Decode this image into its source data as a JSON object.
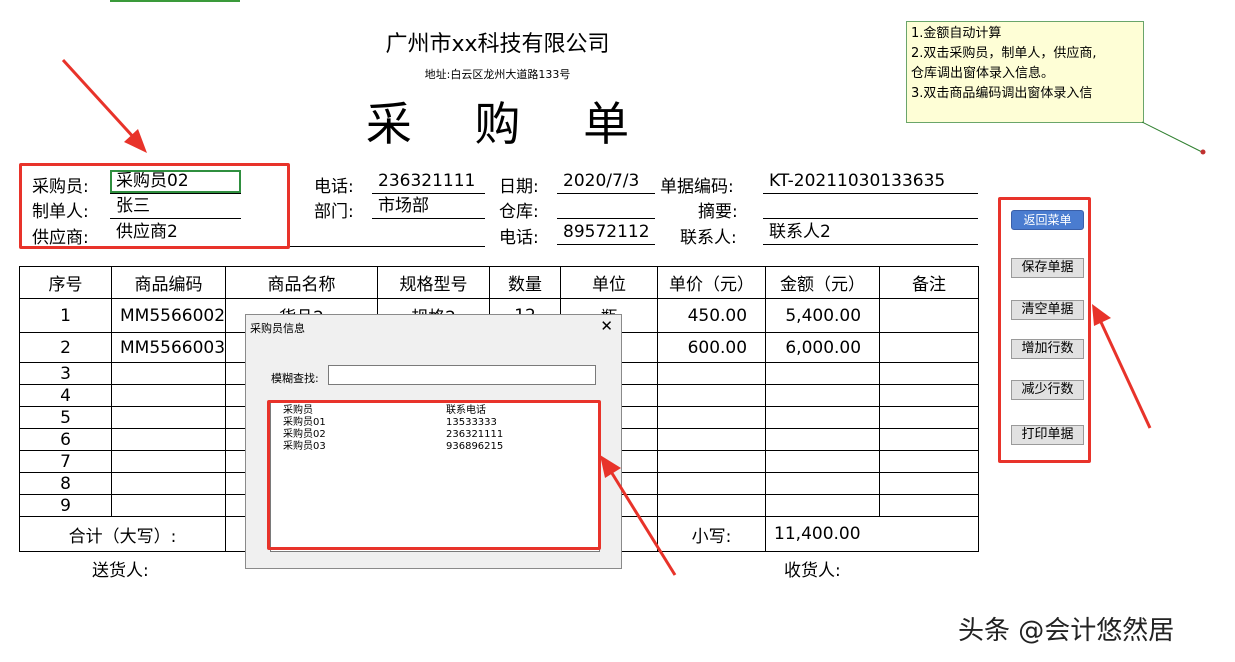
{
  "header": {
    "company": "广州市xx科技有限公司",
    "address": "地址:白云区龙州大道路133号",
    "title": "采 购 单"
  },
  "note": {
    "lines": [
      "1.金额自动计算",
      "2.双击采购员，制单人，供应商,",
      "仓库调出窗体录入信息。",
      "3.双击商品编码调出窗体录入信"
    ]
  },
  "form": {
    "buyer_label": "采购员:",
    "buyer_value": "采购员02",
    "maker_label": "制单人:",
    "maker_value": "张三",
    "supplier_label": "供应商:",
    "supplier_value": "供应商2",
    "phone_label": "电话:",
    "phone_value": "236321111",
    "dept_label": "部门:",
    "dept_value": "市场部",
    "date_label": "日期:",
    "date_value": "2020/7/3",
    "warehouse_label": "仓库:",
    "warehouse_value": "",
    "phone2_label": "电话:",
    "phone2_value": "89572112",
    "docno_label": "单据编码:",
    "docno_value": "KT-20211030133635",
    "summary_label": "摘要:",
    "summary_value": "",
    "contact_label": "联系人:",
    "contact_value": "联系人2"
  },
  "table": {
    "headers": [
      "序号",
      "商品编码",
      "商品名称",
      "规格型号",
      "数量",
      "单位",
      "单价（元）",
      "金额（元）",
      "备注"
    ],
    "rows": [
      [
        "1",
        "MM5566002",
        "货品2",
        "规格2",
        "12",
        "瓶",
        "450.00",
        "5,400.00",
        ""
      ],
      [
        "2",
        "MM5566003",
        "",
        "",
        "",
        "",
        "600.00",
        "6,000.00",
        ""
      ],
      [
        "3",
        "",
        "",
        "",
        "",
        "",
        "",
        "",
        ""
      ],
      [
        "4",
        "",
        "",
        "",
        "",
        "",
        "",
        "",
        ""
      ],
      [
        "5",
        "",
        "",
        "",
        "",
        "",
        "",
        "",
        ""
      ],
      [
        "6",
        "",
        "",
        "",
        "",
        "",
        "",
        "",
        ""
      ],
      [
        "7",
        "",
        "",
        "",
        "",
        "",
        "",
        "",
        ""
      ],
      [
        "8",
        "",
        "",
        "",
        "",
        "",
        "",
        "",
        ""
      ],
      [
        "9",
        "",
        "",
        "",
        "",
        "",
        "",
        "",
        ""
      ]
    ],
    "total_label": "合计（大写）:",
    "small_label": "小写:",
    "small_value": "11,400.00"
  },
  "footer": {
    "deliverer_label": "送货人:",
    "receiver_label": "收货人:"
  },
  "buttons": {
    "back": "返回菜单",
    "save": "保存单据",
    "clear": "清空单据",
    "add_rows": "增加行数",
    "remove_rows": "减少行数",
    "print": "打印单据"
  },
  "dialog": {
    "title": "采购员信息",
    "close": "✕",
    "search_label": "模糊查找:",
    "search_value": "",
    "list": [
      {
        "name": "采购员",
        "phone": "联系电话"
      },
      {
        "name": "采购员01",
        "phone": "13533333"
      },
      {
        "name": "采购员02",
        "phone": "236321111"
      },
      {
        "name": "采购员03",
        "phone": "936896215"
      }
    ]
  },
  "watermark": "头条 @会计悠然居",
  "colors": {
    "annotation_red": "#e8332a",
    "selection_green": "#2f8f3f",
    "note_bg": "#fefed6",
    "back_button": "#4a7cd0"
  }
}
